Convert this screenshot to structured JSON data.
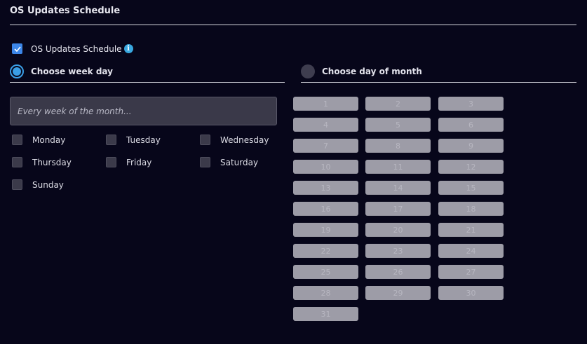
{
  "header": {
    "title": "OS Updates Schedule"
  },
  "enable": {
    "label": "OS Updates Schedule",
    "checked": true,
    "info_icon": "info-icon"
  },
  "week_mode": {
    "label": "Choose week day",
    "selected": true
  },
  "month_mode": {
    "label": "Choose day of month",
    "selected": false
  },
  "week_select": {
    "value": "Every week of the month..."
  },
  "weekdays": [
    {
      "label": "Monday",
      "checked": false
    },
    {
      "label": "Tuesday",
      "checked": false
    },
    {
      "label": "Wednesday",
      "checked": false
    },
    {
      "label": "Thursday",
      "checked": false
    },
    {
      "label": "Friday",
      "checked": false
    },
    {
      "label": "Saturday",
      "checked": false
    },
    {
      "label": "Sunday",
      "checked": false
    }
  ],
  "month_days": [
    "1",
    "2",
    "3",
    "4",
    "5",
    "6",
    "7",
    "8",
    "9",
    "10",
    "11",
    "12",
    "13",
    "14",
    "15",
    "16",
    "17",
    "18",
    "19",
    "20",
    "21",
    "22",
    "23",
    "24",
    "25",
    "26",
    "27",
    "28",
    "29",
    "30",
    "31"
  ],
  "colors": {
    "accent": "#3a9ee6",
    "background": "#07061a",
    "disabled_button": "#9d9ca7"
  }
}
